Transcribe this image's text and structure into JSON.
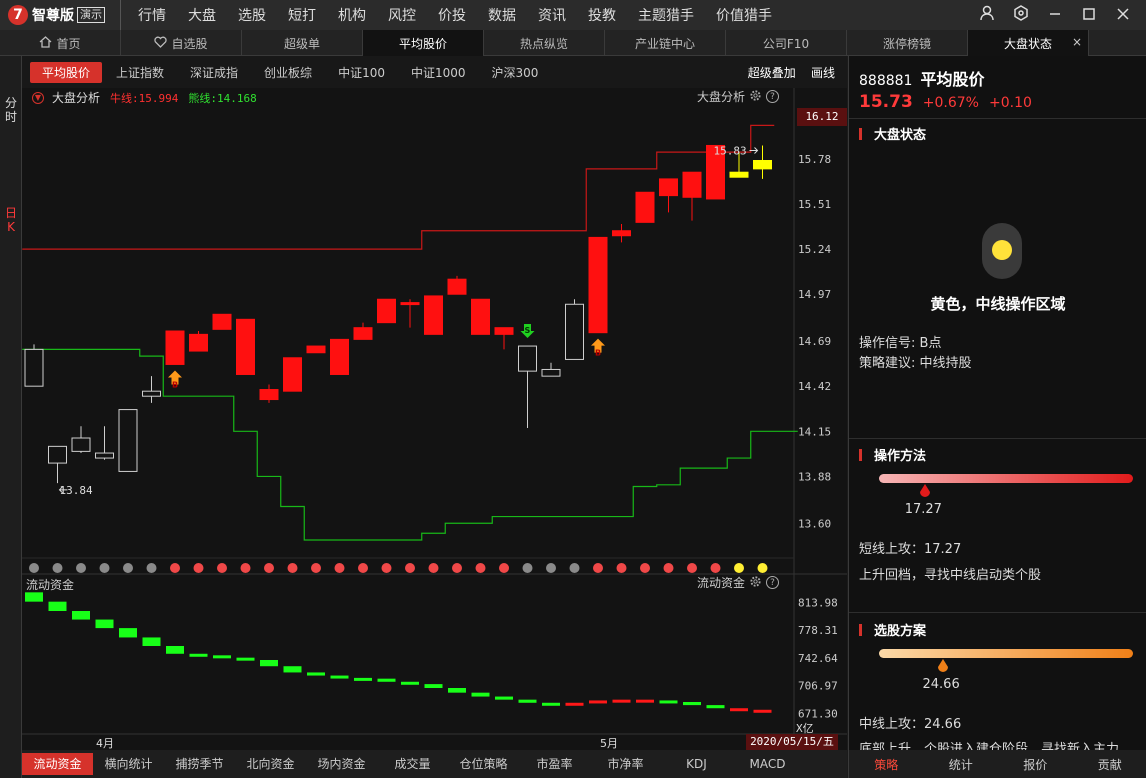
{
  "app": {
    "logo_text": "智尊版",
    "demo_badge": "演示"
  },
  "nav": [
    "行情",
    "大盘",
    "选股",
    "短打",
    "机构",
    "风控",
    "价投",
    "数据",
    "资讯",
    "投教",
    "主题猎手",
    "价值猎手"
  ],
  "tabs": [
    "首页",
    "自选股",
    "超级单",
    "平均股价",
    "热点纵览",
    "产业链中心",
    "公司F10",
    "涨停榜镜",
    "大盘状态"
  ],
  "tabs_meta": {
    "home_icon": "home-icon",
    "heart_icon": "heart-icon",
    "close": "×"
  },
  "left_strip": {
    "fenshi": "分时",
    "rik": "日K"
  },
  "chart_toolbar": {
    "buttons": [
      "平均股价",
      "上证指数",
      "深证成指",
      "创业板综",
      "中证100",
      "中证1000",
      "沪深300"
    ],
    "right": [
      "超级叠加",
      "画线"
    ]
  },
  "legend": {
    "title": "大盘分析",
    "niu": "牛线:15.994",
    "xiong": "熊线:14.168",
    "right_label": "大盘分析"
  },
  "flow": {
    "title": "流动资金",
    "right_label": "流动资金",
    "unit": "X亿"
  },
  "colors": {
    "up": "#ff1010",
    "down": "#10e010",
    "yellow": "#ffff00",
    "red_line": "#c81818",
    "green_line": "#18b818",
    "accent": "#d6322b"
  },
  "chart_data": {
    "type": "candlestick",
    "price_axis": {
      "labels": [
        "16.06",
        "15.78",
        "15.51",
        "15.24",
        "14.97",
        "14.69",
        "14.42",
        "14.15",
        "13.88",
        "13.60"
      ],
      "current": "16.12",
      "ylim": [
        13.44,
        16.12
      ]
    },
    "flow_axis": {
      "labels": [
        "813.98",
        "778.31",
        "742.64",
        "706.97",
        "671.30"
      ],
      "ylim": [
        650,
        830
      ]
    },
    "x_labels": [
      "4月",
      "5月"
    ],
    "date_label": "2020/05/15/五",
    "annotations": {
      "high": "15.83",
      "low": "13.84"
    },
    "candles": [
      {
        "o": 14.42,
        "c": 14.64,
        "h": 14.67,
        "l": 14.42,
        "t": "h"
      },
      {
        "o": 13.96,
        "c": 14.06,
        "h": 14.06,
        "l": 13.84,
        "t": "h"
      },
      {
        "o": 14.03,
        "c": 14.11,
        "h": 14.18,
        "l": 14.02,
        "t": "h"
      },
      {
        "o": 13.99,
        "c": 14.02,
        "h": 14.18,
        "l": 13.98,
        "t": "h"
      },
      {
        "o": 13.91,
        "c": 14.28,
        "h": 14.28,
        "l": 13.91,
        "t": "h"
      },
      {
        "o": 14.36,
        "c": 14.39,
        "h": 14.48,
        "l": 14.32,
        "t": "h"
      },
      {
        "o": 14.55,
        "c": 14.75,
        "h": 14.75,
        "l": 14.55,
        "t": "u"
      },
      {
        "o": 14.63,
        "c": 14.73,
        "h": 14.75,
        "l": 14.63,
        "t": "u"
      },
      {
        "o": 14.76,
        "c": 14.85,
        "h": 14.85,
        "l": 14.76,
        "t": "u"
      },
      {
        "o": 14.49,
        "c": 14.82,
        "h": 14.82,
        "l": 14.49,
        "t": "u"
      },
      {
        "o": 14.34,
        "c": 14.4,
        "h": 14.43,
        "l": 14.32,
        "t": "u"
      },
      {
        "o": 14.39,
        "c": 14.59,
        "h": 14.59,
        "l": 14.39,
        "t": "u"
      },
      {
        "o": 14.62,
        "c": 14.66,
        "h": 14.66,
        "l": 14.62,
        "t": "u"
      },
      {
        "o": 14.49,
        "c": 14.7,
        "h": 14.7,
        "l": 14.49,
        "t": "u"
      },
      {
        "o": 14.7,
        "c": 14.77,
        "h": 14.8,
        "l": 14.7,
        "t": "u"
      },
      {
        "o": 14.8,
        "c": 14.94,
        "h": 14.94,
        "l": 14.8,
        "t": "u"
      },
      {
        "o": 14.91,
        "c": 14.92,
        "h": 14.94,
        "l": 14.77,
        "t": "u"
      },
      {
        "o": 14.73,
        "c": 14.96,
        "h": 14.96,
        "l": 14.73,
        "t": "u"
      },
      {
        "o": 14.97,
        "c": 15.06,
        "h": 15.08,
        "l": 14.97,
        "t": "u"
      },
      {
        "o": 14.73,
        "c": 14.94,
        "h": 14.94,
        "l": 14.73,
        "t": "u"
      },
      {
        "o": 14.73,
        "c": 14.77,
        "h": 14.77,
        "l": 14.64,
        "t": "u"
      },
      {
        "o": 14.51,
        "c": 14.66,
        "h": 14.66,
        "l": 14.17,
        "t": "h"
      },
      {
        "o": 14.48,
        "c": 14.52,
        "h": 14.56,
        "l": 14.48,
        "t": "h"
      },
      {
        "o": 14.58,
        "c": 14.91,
        "h": 14.94,
        "l": 14.58,
        "t": "h"
      },
      {
        "o": 14.74,
        "c": 15.31,
        "h": 15.31,
        "l": 14.74,
        "t": "u"
      },
      {
        "o": 15.32,
        "c": 15.35,
        "h": 15.39,
        "l": 15.28,
        "t": "u"
      },
      {
        "o": 15.4,
        "c": 15.58,
        "h": 15.58,
        "l": 15.4,
        "t": "u"
      },
      {
        "o": 15.56,
        "c": 15.66,
        "h": 15.66,
        "l": 15.46,
        "t": "u"
      },
      {
        "o": 15.55,
        "c": 15.7,
        "h": 15.7,
        "l": 15.41,
        "t": "u"
      },
      {
        "o": 15.54,
        "c": 15.86,
        "h": 15.86,
        "l": 15.54,
        "t": "u"
      },
      {
        "o": 15.67,
        "c": 15.7,
        "h": 15.82,
        "l": 15.67,
        "t": "y"
      },
      {
        "o": 15.72,
        "c": 15.77,
        "h": 15.86,
        "l": 15.66,
        "t": "y"
      }
    ],
    "bull_line": [
      15.24,
      15.24,
      15.24,
      15.24,
      15.24,
      15.24,
      15.24,
      15.24,
      15.24,
      15.24,
      15.24,
      15.24,
      15.24,
      15.24,
      15.24,
      15.24,
      15.24,
      15.35,
      15.35,
      15.35,
      15.35,
      15.35,
      15.35,
      15.35,
      15.72,
      15.72,
      15.72,
      15.82,
      15.82,
      15.82,
      15.82,
      15.98
    ],
    "bear_line": [
      14.64,
      14.64,
      14.64,
      14.64,
      14.64,
      14.6,
      14.36,
      14.36,
      14.36,
      14.15,
      13.88,
      13.7,
      13.5,
      13.5,
      13.5,
      13.5,
      13.5,
      13.54,
      13.6,
      13.6,
      13.64,
      13.64,
      13.64,
      13.64,
      13.64,
      13.64,
      13.82,
      13.83,
      13.93,
      13.93,
      13.99,
      14.15,
      14.15
    ],
    "signals": [
      {
        "i": 6,
        "t": "B"
      },
      {
        "i": 21,
        "t": "S"
      },
      {
        "i": 24,
        "t": "B"
      }
    ],
    "dots": [
      "g",
      "g",
      "g",
      "g",
      "g",
      "g",
      "r",
      "r",
      "r",
      "r",
      "r",
      "r",
      "r",
      "r",
      "r",
      "r",
      "r",
      "r",
      "r",
      "r",
      "r",
      "g",
      "g",
      "g",
      "r",
      "r",
      "r",
      "r",
      "r",
      "r",
      "y",
      "y"
    ],
    "flow": [
      815,
      803,
      792,
      781,
      769,
      758,
      748,
      746,
      743,
      740,
      732,
      724,
      720,
      717,
      716,
      712,
      709,
      704,
      698,
      693,
      689,
      685,
      684,
      685,
      688,
      689,
      688,
      686,
      682,
      678,
      676,
      673
    ],
    "flow_dir": [
      "d",
      "d",
      "d",
      "d",
      "d",
      "d",
      "d",
      "d",
      "d",
      "d",
      "d",
      "d",
      "d",
      "d",
      "d",
      "d",
      "d",
      "d",
      "d",
      "d",
      "d",
      "d",
      "d",
      "u",
      "u",
      "u",
      "u",
      "d",
      "d",
      "d",
      "u",
      "u"
    ]
  },
  "bottom_tabs": [
    "流动资金",
    "横向统计",
    "捕捞季节",
    "北向资金",
    "场内资金",
    "成交量",
    "仓位策略",
    "市盈率",
    "市净率",
    "KDJ",
    "MACD"
  ],
  "right_panel": {
    "code": "888881",
    "name": "平均股价",
    "price": "15.73",
    "pct": "+0.67%",
    "chg": "+0.10",
    "market_state_title": "大盘状态",
    "state_text": "黄色，中线操作区域",
    "signal_label": "操作信号:",
    "signal_value": "B点",
    "advice_label": "策略建议:",
    "advice_value": "中线持股",
    "method_title": "操作方法",
    "method_value": 17.27,
    "method_pin_fraction": 0.18,
    "short_attack": "短线上攻：17.27",
    "short_desc": "上升回档，寻找中线启动类个股",
    "plan_title": "选股方案",
    "plan_value": 24.66,
    "plan_pin_fraction": 0.25,
    "mid_attack": "中线上攻：24.66",
    "mid_desc_partial": "底部上升，个股进入建仓阶段，寻找新入主力",
    "tabs": [
      "策略",
      "统计",
      "报价",
      "贡献"
    ]
  }
}
